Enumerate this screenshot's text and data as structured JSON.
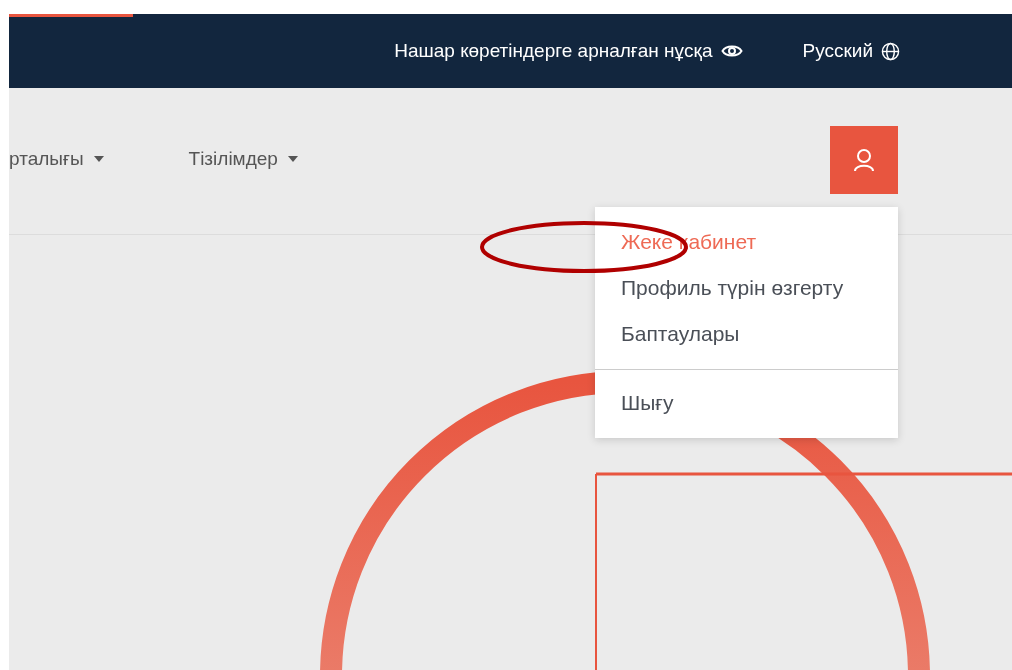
{
  "top_bar": {
    "accessibility_link": "Нашар көретіндерге арналған нұсқа",
    "language_link": "Русский"
  },
  "nav": {
    "items": [
      {
        "label": "рталығы"
      },
      {
        "label": "Тізілімдер"
      }
    ]
  },
  "user_menu": {
    "items": [
      {
        "label": "Жеке кабинет",
        "selected": true
      },
      {
        "label": "Профиль түрін өзгерту",
        "selected": false
      },
      {
        "label": "Баптаулары",
        "selected": false
      }
    ],
    "footer_items": [
      {
        "label": "Шығу",
        "selected": false
      }
    ]
  },
  "annotation": {
    "kind": "ellipse",
    "color": "#b00000"
  }
}
